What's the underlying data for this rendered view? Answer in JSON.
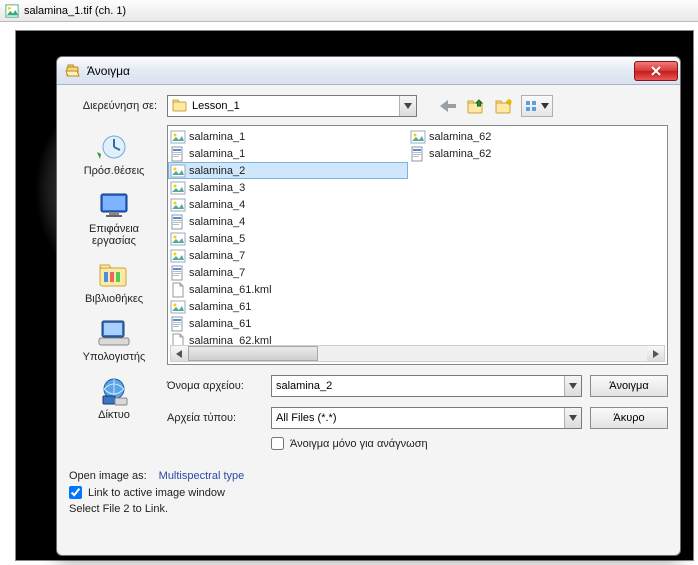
{
  "parent": {
    "title": "salamina_1.tif (ch. 1)"
  },
  "dialog": {
    "title": "Άνοιγμα",
    "close_tooltip": "Close",
    "lookin_label": "Διερεύνηση σε:",
    "lookin_value": "Lesson_1",
    "places": [
      {
        "key": "recent",
        "label": "Πρόσ.θέσεις"
      },
      {
        "key": "desktop",
        "label": "Επιφάνεια εργασίας"
      },
      {
        "key": "libraries",
        "label": "Βιβλιοθήκες"
      },
      {
        "key": "computer",
        "label": "Υπολογιστής"
      },
      {
        "key": "network",
        "label": "Δίκτυο"
      }
    ],
    "files_col1": [
      {
        "name": "salamina_1",
        "icon": "img",
        "selected": false
      },
      {
        "name": "salamina_1",
        "icon": "hdr",
        "selected": false
      },
      {
        "name": "salamina_2",
        "icon": "img",
        "selected": true
      },
      {
        "name": "salamina_3",
        "icon": "img",
        "selected": false
      },
      {
        "name": "salamina_4",
        "icon": "img",
        "selected": false
      },
      {
        "name": "salamina_4",
        "icon": "hdr",
        "selected": false
      },
      {
        "name": "salamina_5",
        "icon": "img",
        "selected": false
      },
      {
        "name": "salamina_7",
        "icon": "img",
        "selected": false
      },
      {
        "name": "salamina_7",
        "icon": "hdr",
        "selected": false
      },
      {
        "name": "salamina_61.kml",
        "icon": "doc",
        "selected": false
      },
      {
        "name": "salamina_61",
        "icon": "img",
        "selected": false
      },
      {
        "name": "salamina_61",
        "icon": "hdr",
        "selected": false
      },
      {
        "name": "salamina_62.kml",
        "icon": "doc",
        "selected": false
      }
    ],
    "files_col2": [
      {
        "name": "salamina_62",
        "icon": "img",
        "selected": false
      },
      {
        "name": "salamina_62",
        "icon": "hdr",
        "selected": false
      }
    ],
    "filename_label": "Όνομα αρχείου:",
    "filename_value": "salamina_2",
    "filetype_label": "Αρχεία τύπου:",
    "filetype_value": "All Files (*.*)",
    "readonly_label": "Άνοιγμα μόνο για ανάγνωση",
    "open_button": "Άνοιγμα",
    "cancel_button": "Άκυρο"
  },
  "bottom": {
    "openas_label": "Open image as:",
    "openas_value": "Multispectral type",
    "link_checked": true,
    "link_label": "Link to active image window",
    "selectfile_text": "Select File  2 to Link."
  }
}
